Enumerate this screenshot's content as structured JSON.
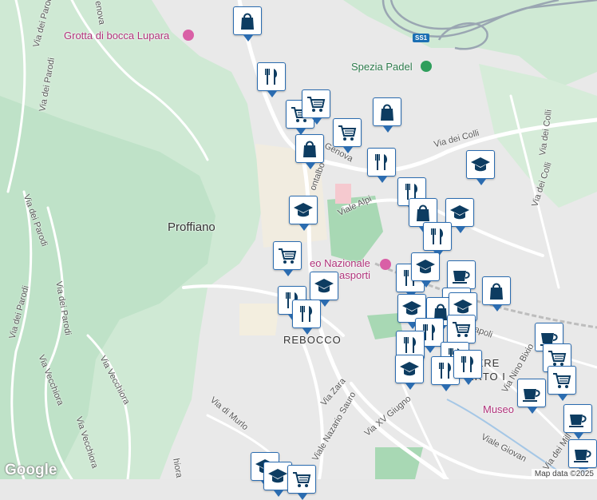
{
  "map": {
    "place_labels": {
      "proffiano": "Proffiano",
      "rebocco": "REBOCCO",
      "quartiere": "IERE",
      "umberto": "ERTO I"
    },
    "poi_labels": {
      "grotta": "Grotta di bocca Lupara",
      "padel": "Spezia Padel",
      "museo_trasporti_1": "eo Nazionale",
      "museo_trasporti_2": "asporti",
      "museo_2": "Museo"
    },
    "roads": {
      "genova_top": "enova",
      "via_dei_parodi_1": "Via dei Parodi",
      "via_dei_parodi_2": "Via dei Parodi",
      "via_dei_parodi_3": "Via dei Parodi",
      "via_dei_parodi_4": "Via dei Parodi",
      "via_dei_parodi_5": "Via dei Parodi",
      "genova_mid": "Genova",
      "montalbano": "ontalbo",
      "viale_alpi": "Viale Alpi",
      "via_dei_colli_1": "Via dei Colli",
      "via_dei_colli_2": "Via dei Colli",
      "via_dei_colli_3": "Via dei Colli",
      "via_vecchiora_1": "Via Vecchiora",
      "via_vecchiora_2": "Via Vecchiora",
      "via_vecchiora_3": "Via Vecchiora",
      "via_vecchiora_4": "Via Vecchiora",
      "via_di_murlo": "Via di Murlo",
      "via_zara": "Via Zara",
      "viale_nazario_sauro": "Viale Nazario Sauro",
      "via_xv_giugno": "Via XV Giugno",
      "via_nino_bixio": "Via Nino Bixio",
      "viale_giovanni": "Viale Giovan",
      "napoli": "apoli",
      "via_dei_mille": "Via dei Mill",
      "via_dei_parodi_label_a": "Via del Parodi",
      "via_chiora": "hiora",
      "via": "Via"
    },
    "shield": "SS1",
    "attribution": {
      "logo": "Google",
      "data": "Map data ©2025"
    }
  },
  "markers": [
    {
      "type": "shopping-bag"
    },
    {
      "type": "restaurant"
    },
    {
      "type": "grocery"
    },
    {
      "type": "grocery"
    },
    {
      "type": "shopping-bag"
    },
    {
      "type": "grocery"
    },
    {
      "type": "shopping-bag"
    },
    {
      "type": "restaurant"
    },
    {
      "type": "school"
    },
    {
      "type": "restaurant"
    },
    {
      "type": "shopping-bag"
    },
    {
      "type": "school"
    },
    {
      "type": "school"
    },
    {
      "type": "restaurant"
    },
    {
      "type": "grocery"
    },
    {
      "type": "school"
    },
    {
      "type": "restaurant"
    },
    {
      "type": "restaurant"
    },
    {
      "type": "restaurant"
    },
    {
      "type": "cafe"
    },
    {
      "type": "school"
    },
    {
      "type": "shopping-bag"
    },
    {
      "type": "school"
    },
    {
      "type": "school"
    },
    {
      "type": "shopping-bag"
    },
    {
      "type": "school"
    },
    {
      "type": "grocery"
    },
    {
      "type": "restaurant"
    },
    {
      "type": "restaurant"
    },
    {
      "type": "restaurant"
    },
    {
      "type": "school"
    },
    {
      "type": "restaurant"
    },
    {
      "type": "restaurant"
    },
    {
      "type": "cafe"
    },
    {
      "type": "grocery"
    },
    {
      "type": "grocery"
    },
    {
      "type": "cafe"
    },
    {
      "type": "cafe"
    },
    {
      "type": "cafe"
    },
    {
      "type": "school"
    },
    {
      "type": "school"
    },
    {
      "type": "grocery"
    }
  ],
  "colors": {
    "park": "#b9dfc4",
    "hill": "#cde8d2",
    "urban": "#e6e6e6",
    "road": "#ffffff",
    "pin_border": "#2b6cb0",
    "pin_icon": "#0d3c61",
    "poi_pink": "#b0327a",
    "poi_green": "#2c7a4b"
  }
}
